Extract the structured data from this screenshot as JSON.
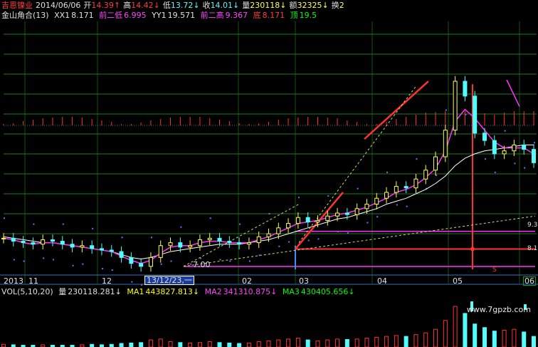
{
  "header": {
    "stock_name": "吉恩镍业",
    "date": "2014/06/06",
    "open_label": "开",
    "open_value": "14.39↑",
    "high_label": "高",
    "high_value": "14.42↓",
    "low_label": "低",
    "low_value": "13.72↓",
    "close_label": "收",
    "close_value": "14.01↓",
    "volume_label": "量",
    "volume_value": "230118↓",
    "amount_label": "额",
    "amount_value": "32325↓",
    "turnover_label": "换",
    "turnover_value": "2"
  },
  "indicator": {
    "name": "金山角合(13)",
    "xx1_label": "XX1",
    "xx1_value": "8.171",
    "prev2_low_label": "前二低",
    "prev2_low_value": "6.995",
    "yy1_label": "YY1",
    "yy1_value": "19.571",
    "prev2_high_label": "前二高",
    "prev2_high_value": "9.367",
    "bottom_label": "底",
    "bottom_value": "8.171",
    "top_label": "顶",
    "top_value": "19.5"
  },
  "price_annotations": {
    "low_marker": "7.00",
    "level_93": "9.3",
    "level_81": "8.1",
    "signal_char": "S"
  },
  "x_axis": {
    "labels": [
      "2013",
      "11",
      "12",
      "13/12/23,一",
      "02",
      "03",
      "04",
      "05",
      "06"
    ]
  },
  "volume_panel": {
    "name": "VOL(5,10,20)",
    "vol_label": "量",
    "vol_value": "230118.281↓",
    "ma1_label": "MA1",
    "ma1_value": "443827.813↓",
    "ma2_label": "MA2",
    "ma2_value": "341310.875↓",
    "ma3_label": "MA3",
    "ma3_value": "430405.656↓"
  },
  "watermark": "www.7gpzb.com",
  "colors": {
    "bg": "#000000",
    "up": "#ff3232",
    "down": "#54fcfc",
    "candle_yellow": "#ffff54",
    "ma_white": "#ffffff",
    "ma_magenta": "#ff33ff",
    "grid_green": "#1f7a1f",
    "label_yellow": "#ffff00",
    "label_green": "#00ff00",
    "label_magenta": "#ff44ff",
    "label_red": "#ff3a3a",
    "label_white": "#e0e0e0",
    "label_cyan": "#00ffff"
  },
  "chart_data": [
    {
      "type": "line",
      "panel": "price",
      "x_label_values": [
        "2013",
        "11",
        "12",
        "13/12/23,一",
        "02",
        "03",
        "04",
        "05",
        "06"
      ],
      "levels": {
        "xx1": 8.171,
        "prev2_low": 6.995,
        "yy1": 19.571,
        "prev2_high": 9.367,
        "bottom": 8.171
      },
      "price_low_marked": 7.0,
      "close_series_approx": [
        8.9,
        8.7,
        8.6,
        8.5,
        8.8,
        8.7,
        8.5,
        8.3,
        8.4,
        8.2,
        8.1,
        8.0,
        7.6,
        7.2,
        7.0,
        7.6,
        8.4,
        8.6,
        8.3,
        8.4,
        8.8,
        8.9,
        8.7,
        8.6,
        8.5,
        8.6,
        9.0,
        9.2,
        9.6,
        9.9,
        10.3,
        10.0,
        10.1,
        10.4,
        10.6,
        10.5,
        10.9,
        11.2,
        11.6,
        12.0,
        12.4,
        12.3,
        12.9,
        13.5,
        14.4,
        16.2,
        19.5,
        18.5,
        16.0,
        15.5,
        14.6,
        14.8,
        15.2,
        14.9,
        14.0
      ],
      "ma_white_approx": [
        9.0,
        8.9,
        8.8,
        8.7,
        8.6,
        8.6,
        8.5,
        8.4,
        8.3,
        8.2,
        8.1,
        8.0,
        7.8,
        7.6,
        7.5,
        7.6,
        7.8,
        8.0,
        8.1,
        8.2,
        8.3,
        8.4,
        8.5,
        8.5,
        8.5,
        8.6,
        8.7,
        8.8,
        9.0,
        9.2,
        9.4,
        9.6,
        9.8,
        10.0,
        10.2,
        10.3,
        10.5,
        10.7,
        10.9,
        11.2,
        11.4,
        11.6,
        11.9,
        12.2,
        12.6,
        13.1,
        13.8,
        14.3,
        14.6,
        14.8,
        14.9,
        15.0,
        15.1,
        15.2,
        15.2
      ],
      "ma_magenta_approx": [
        8.9,
        8.8,
        8.6,
        8.5,
        8.6,
        8.6,
        8.5,
        8.4,
        8.3,
        8.2,
        8.1,
        8.0,
        7.7,
        7.4,
        7.2,
        7.4,
        7.9,
        8.3,
        8.4,
        8.4,
        8.6,
        8.7,
        8.7,
        8.6,
        8.6,
        8.6,
        8.8,
        9.0,
        9.3,
        9.6,
        9.9,
        10.0,
        10.1,
        10.3,
        10.5,
        10.6,
        10.8,
        11.0,
        11.3,
        11.6,
        12.0,
        12.2,
        12.5,
        13.0,
        13.6,
        14.8,
        16.8,
        17.6,
        17.0,
        16.2,
        15.4,
        15.0,
        15.0,
        15.0,
        14.6
      ]
    },
    {
      "type": "bar",
      "panel": "volume",
      "series": [
        {
          "name": "量",
          "values_approx": [
            0.3,
            0.25,
            0.2,
            0.2,
            0.25,
            0.2,
            0.2,
            0.2,
            0.25,
            0.3,
            0.25,
            0.3,
            0.4,
            0.45,
            0.5,
            0.8,
            0.9,
            0.6,
            0.5,
            0.45,
            0.5,
            0.6,
            0.5,
            0.45,
            0.4,
            0.45,
            0.6,
            0.7,
            0.8,
            0.9,
            1.0,
            0.8,
            0.7,
            0.8,
            0.9,
            0.85,
            0.9,
            1.0,
            1.1,
            1.2,
            1.3,
            1.2,
            1.4,
            1.6,
            2.0,
            3.0,
            4.6,
            3.8,
            2.6,
            2.2,
            1.8,
            1.9,
            2.0,
            1.7,
            1.2
          ]
        }
      ]
    }
  ]
}
